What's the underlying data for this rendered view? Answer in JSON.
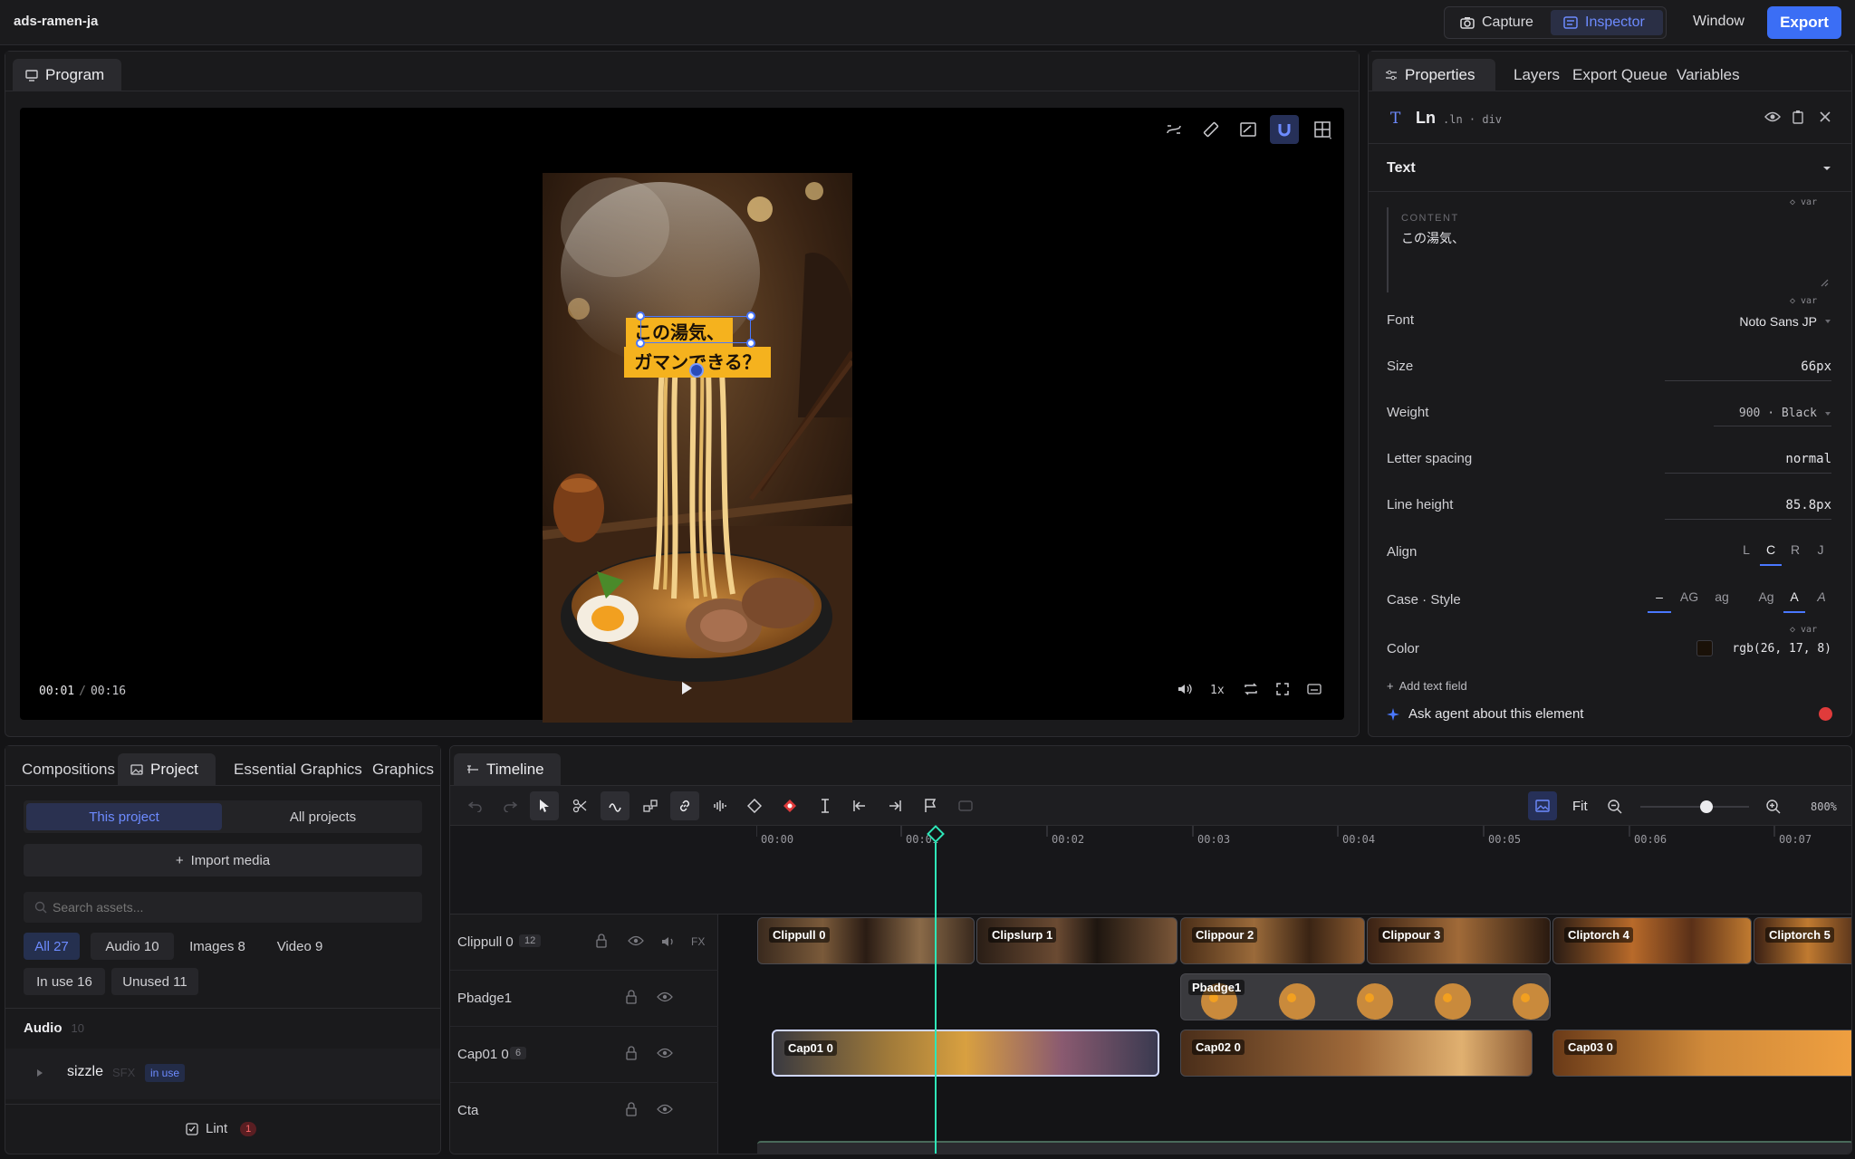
{
  "app": {
    "title": "ads-ramen-ja"
  },
  "topbar": {
    "capture_label": "Capture",
    "inspector_label": "Inspector",
    "window_label": "Window",
    "export_label": "Export"
  },
  "program": {
    "tab_label": "Program",
    "caption_line1": "この湯気、",
    "caption_line2": "ガマンできる？",
    "current_time": "00:01",
    "separator": "/",
    "duration": "00:16",
    "speed": "1x"
  },
  "inspector": {
    "tabs": [
      "Properties",
      "Layers",
      "Export Queue",
      "Variables"
    ],
    "element_name": "Ln",
    "element_selector": ".ln · div",
    "section_title": "Text",
    "content_label": "CONTENT",
    "content_value": "この湯気、",
    "var_badge": "◇ var",
    "font_label": "Font",
    "font_value": "Noto Sans JP",
    "size_label": "Size",
    "size_value": "66px",
    "weight_label": "Weight",
    "weight_value": "900 · Black",
    "letter_spacing_label": "Letter spacing",
    "letter_spacing_value": "normal",
    "line_height_label": "Line height",
    "line_height_value": "85.8px",
    "align_label": "Align",
    "align_options": [
      "L",
      "C",
      "R",
      "J"
    ],
    "align_selected": "C",
    "case_label": "Case · Style",
    "case_options": [
      "–",
      "AG",
      "ag",
      "Ag",
      "A",
      "A"
    ],
    "color_label": "Color",
    "color_value": "rgb(26, 17, 8)",
    "color_swatch": "#1a1108",
    "add_text_field": "Add text field",
    "ask_agent": "Ask agent about this element"
  },
  "project": {
    "tabs": [
      "Compositions",
      "Project",
      "Essential Graphics",
      "Graphics"
    ],
    "scope": [
      "This project",
      "All projects"
    ],
    "import_label": "Import media",
    "search_placeholder": "Search assets...",
    "filters": [
      "All 27",
      "Audio 10",
      "Images 8",
      "Video 9",
      "In use 16",
      "Unused 11"
    ],
    "audio_header": "Audio",
    "audio_count": "10",
    "asset_name": "sizzle",
    "asset_type": "SFX",
    "asset_badge": "in use",
    "lint_label": "Lint",
    "lint_count": "1"
  },
  "timeline": {
    "tab_label": "Timeline",
    "fit_label": "Fit",
    "zoom": "800%",
    "zoom_level": 0.61,
    "ticks": [
      "00:00",
      "00:01",
      "00:02",
      "00:03",
      "00:04",
      "00:05",
      "00:06",
      "00:07"
    ],
    "tracks": [
      {
        "name": "Clippull 0",
        "count": "12",
        "fx": "FX"
      },
      {
        "name": "Pbadge1",
        "count": ""
      },
      {
        "name": "Cap01 0",
        "count": "6"
      },
      {
        "name": "Cta",
        "count": ""
      }
    ],
    "clips_row1": [
      "Clippull 0",
      "Clipslurp 1",
      "Clippour 2",
      "Clippour 3",
      "Cliptorch 4",
      "Cliptorch 5"
    ],
    "clips_row2": [
      "Pbadge1"
    ],
    "clips_row3": [
      "Cap01 0",
      "Cap02 0",
      "Cap03 0"
    ]
  },
  "colors": {
    "accent": "#3b6ef5",
    "playhead": "#2ee6b8",
    "caption_bg": "#f5b21e",
    "record": "#e03b3b"
  }
}
